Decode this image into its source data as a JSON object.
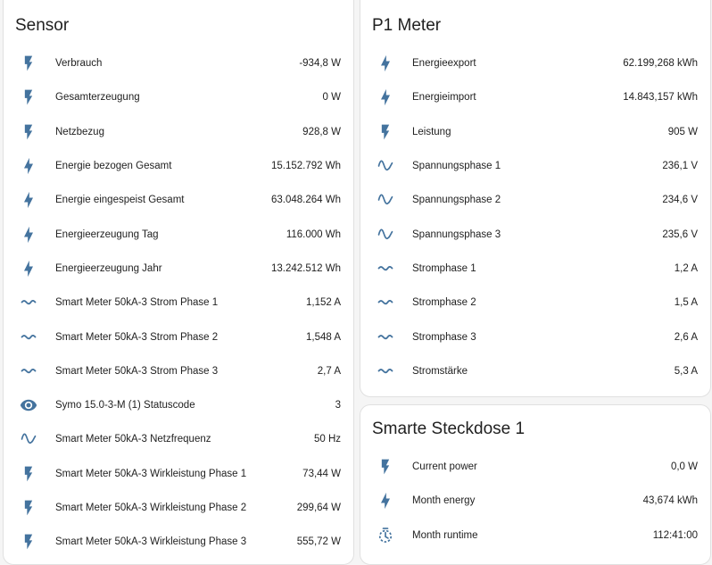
{
  "colors": {
    "icon": "#44739e",
    "card_bg": "#ffffff",
    "page_bg": "#f5f5f5",
    "text": "#212121"
  },
  "sensor": {
    "title": "Sensor",
    "rows": [
      {
        "icon": "flash-icon",
        "label": "Verbrauch",
        "value": "-934,8 W"
      },
      {
        "icon": "flash-icon",
        "label": "Gesamterzeugung",
        "value": "0 W"
      },
      {
        "icon": "flash-icon",
        "label": "Netzbezug",
        "value": "928,8 W"
      },
      {
        "icon": "lightning-bolt-icon",
        "label": "Energie bezogen Gesamt",
        "value": "15.152.792 Wh"
      },
      {
        "icon": "lightning-bolt-icon",
        "label": "Energie eingespeist Gesamt",
        "value": "63.048.264 Wh"
      },
      {
        "icon": "lightning-bolt-icon",
        "label": "Energieerzeugung Tag",
        "value": "116.000 Wh"
      },
      {
        "icon": "lightning-bolt-icon",
        "label": "Energieerzeugung Jahr",
        "value": "13.242.512 Wh"
      },
      {
        "icon": "current-ac-icon",
        "label": "Smart Meter 50kA-3 Strom Phase 1",
        "value": "1,152 A"
      },
      {
        "icon": "current-ac-icon",
        "label": "Smart Meter 50kA-3 Strom Phase 2",
        "value": "1,548 A"
      },
      {
        "icon": "current-ac-icon",
        "label": "Smart Meter 50kA-3 Strom Phase 3",
        "value": "2,7 A"
      },
      {
        "icon": "eye-icon",
        "label": "Symo 15.0-3-M (1) Statuscode",
        "value": "3"
      },
      {
        "icon": "sine-wave-icon",
        "label": "Smart Meter 50kA-3 Netzfrequenz",
        "value": "50 Hz"
      },
      {
        "icon": "flash-icon",
        "label": "Smart Meter 50kA-3 Wirkleistung Phase 1",
        "value": "73,44 W"
      },
      {
        "icon": "flash-icon",
        "label": "Smart Meter 50kA-3 Wirkleistung Phase 2",
        "value": "299,64 W"
      },
      {
        "icon": "flash-icon",
        "label": "Smart Meter 50kA-3 Wirkleistung Phase 3",
        "value": "555,72 W"
      }
    ]
  },
  "p1": {
    "title": "P1 Meter",
    "rows": [
      {
        "icon": "lightning-bolt-icon",
        "label": "Energieexport",
        "value": "62.199,268 kWh"
      },
      {
        "icon": "lightning-bolt-icon",
        "label": "Energieimport",
        "value": "14.843,157 kWh"
      },
      {
        "icon": "flash-icon",
        "label": "Leistung",
        "value": "905 W"
      },
      {
        "icon": "sine-wave-icon",
        "label": "Spannungsphase 1",
        "value": "236,1 V"
      },
      {
        "icon": "sine-wave-icon",
        "label": "Spannungsphase 2",
        "value": "234,6 V"
      },
      {
        "icon": "sine-wave-icon",
        "label": "Spannungsphase 3",
        "value": "235,6 V"
      },
      {
        "icon": "current-ac-icon",
        "label": "Stromphase 1",
        "value": "1,2 A"
      },
      {
        "icon": "current-ac-icon",
        "label": "Stromphase 2",
        "value": "1,5 A"
      },
      {
        "icon": "current-ac-icon",
        "label": "Stromphase 3",
        "value": "2,6 A"
      },
      {
        "icon": "current-ac-icon",
        "label": "Stromstärke",
        "value": "5,3 A"
      }
    ]
  },
  "plug": {
    "title": "Smarte Steckdose 1",
    "rows": [
      {
        "icon": "flash-icon",
        "label": "Current power",
        "value": "0,0 W"
      },
      {
        "icon": "lightning-bolt-icon",
        "label": "Month energy",
        "value": "43,674 kWh"
      },
      {
        "icon": "timer-icon",
        "label": "Month runtime",
        "value": "112:41:00"
      }
    ]
  }
}
